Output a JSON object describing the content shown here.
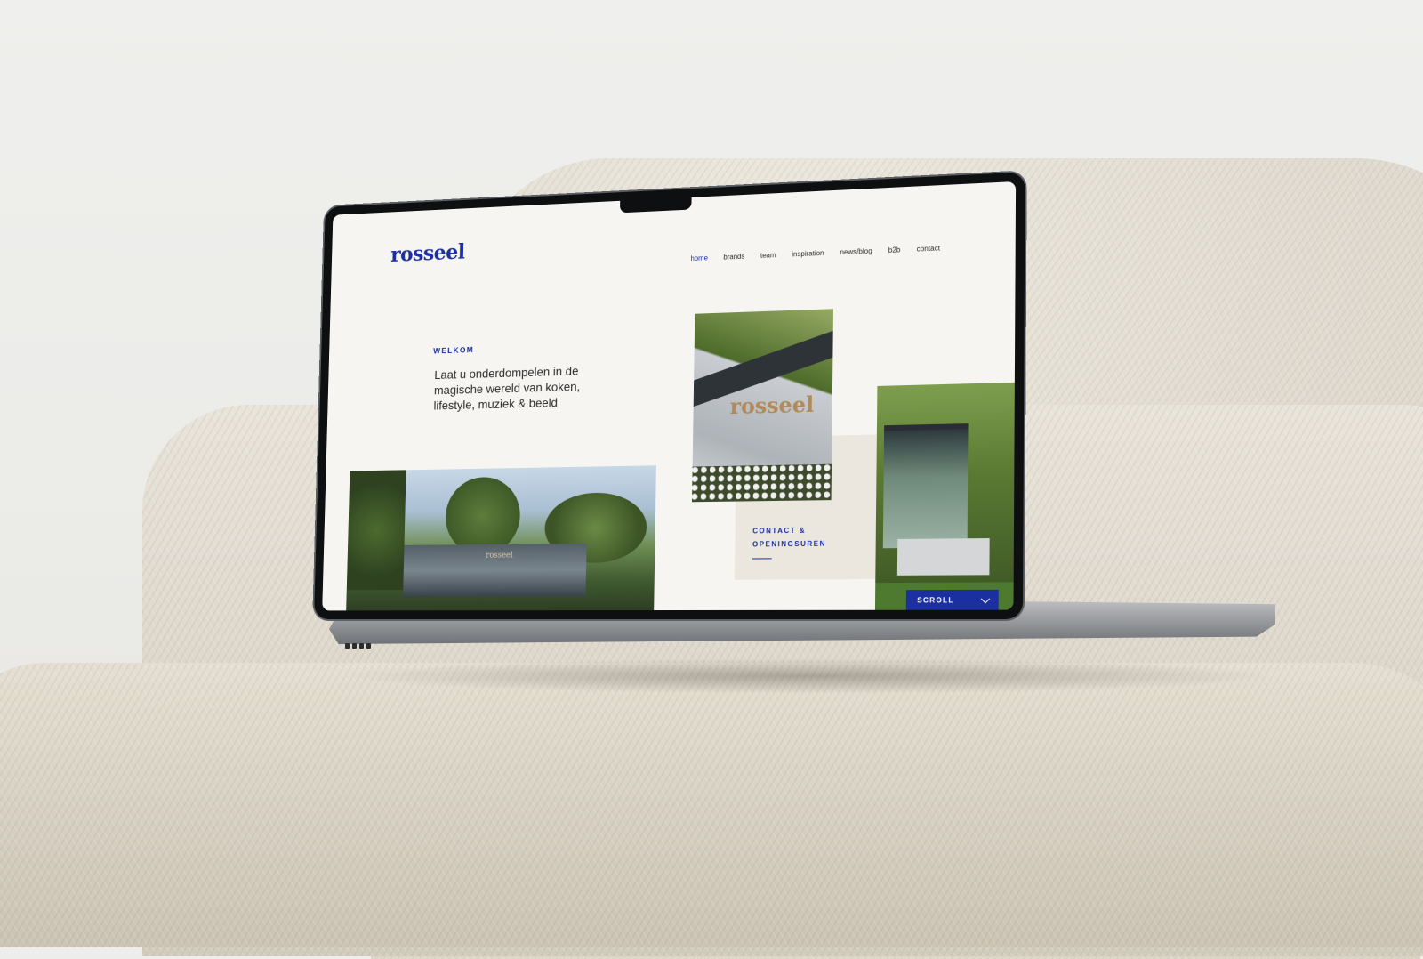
{
  "site": {
    "logo": "rosseel",
    "nav": [
      "home",
      "brands",
      "team",
      "inspiration",
      "news/blog",
      "b2b",
      "contact"
    ],
    "active_nav": "home"
  },
  "hero": {
    "eyebrow": "WELKOM",
    "headline": "Laat u onderdompelen in de\nmagische wereld van koken,\nlifestyle, muziek & beeld"
  },
  "photos": {
    "main_sign": "rosseel",
    "sign_word": "rosseel"
  },
  "contact_card": {
    "label": "CONTACT &\nOPENINGSUREN"
  },
  "scroll": {
    "label": "SCROLL",
    "icon": "chevron-down-icon"
  },
  "colors": {
    "brand_blue": "#1b2fa0",
    "page_bg": "#f6f5f2",
    "card_bg": "#ebe7df",
    "sofa": "#ddd7cb"
  }
}
